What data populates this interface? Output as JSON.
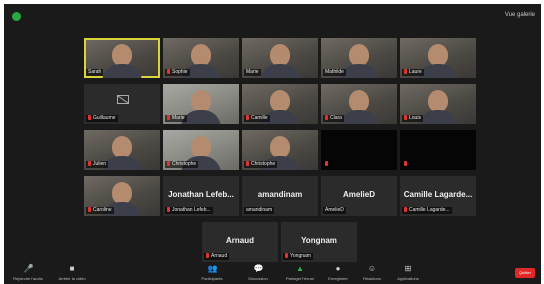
{
  "window": {
    "view_label": "Vue galerie"
  },
  "participants": [
    {
      "name": "Sarah",
      "video": true,
      "active": true,
      "muted": false
    },
    {
      "name": "Sophie",
      "video": true,
      "muted": true
    },
    {
      "name": "Marie",
      "video": true,
      "muted": false
    },
    {
      "name": "Mathilde",
      "video": true,
      "muted": false
    },
    {
      "name": "Laure",
      "video": true,
      "muted": true
    },
    {
      "name": "Guillaume",
      "video": false,
      "muted": true
    },
    {
      "name": "Marie",
      "video": true,
      "light": true,
      "muted": true
    },
    {
      "name": "Camille",
      "video": true,
      "muted": true
    },
    {
      "name": "Clara",
      "video": true,
      "muted": true
    },
    {
      "name": "Louis",
      "video": true,
      "muted": true
    },
    {
      "name": "Julien",
      "video": true,
      "muted": true
    },
    {
      "name": "Christophe",
      "video": true,
      "light": true,
      "muted": true
    },
    {
      "name": "Christophe",
      "video": true,
      "muted": true
    },
    {
      "name": "",
      "video": false,
      "dark": true,
      "muted": true
    },
    {
      "name": "",
      "video": false,
      "dark": true,
      "muted": true
    },
    {
      "name": "Caroline",
      "video": true,
      "muted": true
    },
    {
      "name": "Jonathan Lefeb...",
      "video": false,
      "muted": true
    },
    {
      "name": "amandinam",
      "video": false,
      "muted": false
    },
    {
      "name": "AmelieD",
      "video": false,
      "muted": false
    },
    {
      "name": "Camille Lagarde...",
      "video": false,
      "muted": true
    },
    {
      "name": "Arnaud",
      "video": false,
      "muted": true
    },
    {
      "name": "Yongnam",
      "video": false,
      "muted": true
    }
  ],
  "toolbar": {
    "items": [
      {
        "label": "Rejoindre l'audio",
        "icon": "microphone-icon"
      },
      {
        "label": "Arrêter la vidéo",
        "icon": "video-camera-icon"
      },
      {
        "label": "Participants",
        "icon": "participants-icon"
      },
      {
        "label": "Discussion",
        "icon": "chat-icon"
      },
      {
        "label": "Partager l'écran",
        "icon": "share-screen-icon"
      },
      {
        "label": "Enregistrer",
        "icon": "record-icon"
      },
      {
        "label": "Réactions",
        "icon": "reactions-icon"
      },
      {
        "label": "Applications",
        "icon": "apps-icon"
      }
    ],
    "leave_label": "Quitter"
  }
}
